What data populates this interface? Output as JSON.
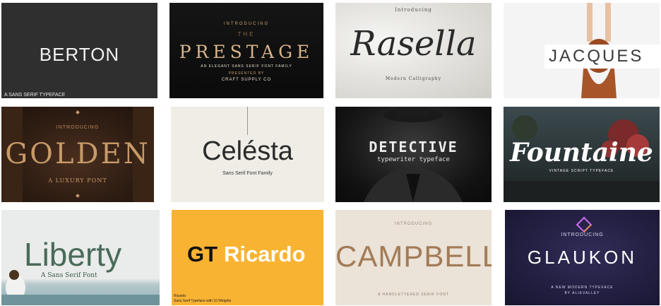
{
  "tiles": [
    {
      "title": "BERTON",
      "subtitle": "A SANS SERIF TYPEFACE"
    },
    {
      "intro": "INTRODUCING",
      "the": "THE",
      "title": "PRESTAGE",
      "line1": "AN ELEGANT SANS SERIF FONT FAMILY",
      "line2": "PRESENTED BY",
      "line3": "CRAFT SUPPLY CO"
    },
    {
      "intro": "Introducing",
      "title": "Rasella",
      "subtitle": "Modern Calligraphy"
    },
    {
      "title": "JACQUES"
    },
    {
      "intro": "INTRODUCING",
      "title": "GOLDEN",
      "subtitle": "A LUXURY FONT"
    },
    {
      "title": "Celésta",
      "subtitle": "Sans Serif Font Family"
    },
    {
      "title": "DETECTIVE",
      "subtitle": "typewriter typeface"
    },
    {
      "title": "Fountaine",
      "subtitle": "VINTAGE SCRIPT TYPEFACE"
    },
    {
      "title": "Liberty",
      "subtitle": "A Sans Serif Font"
    },
    {
      "title_part1": "GT",
      "title_part2": "Ricardo",
      "line1": "Ricardo",
      "line2": "Sans Serif Typeface with 10 Weights"
    },
    {
      "intro": "INTRODUCING",
      "title": "CAMPBELL",
      "subtitle": "A HANDLETTERED SERIF FONT"
    },
    {
      "intro": "INTRODUCING",
      "title": "GLAUKON",
      "line1": "A NEW MODERN TYPEFACE",
      "line2": "BY ALIEVALLEY"
    }
  ]
}
